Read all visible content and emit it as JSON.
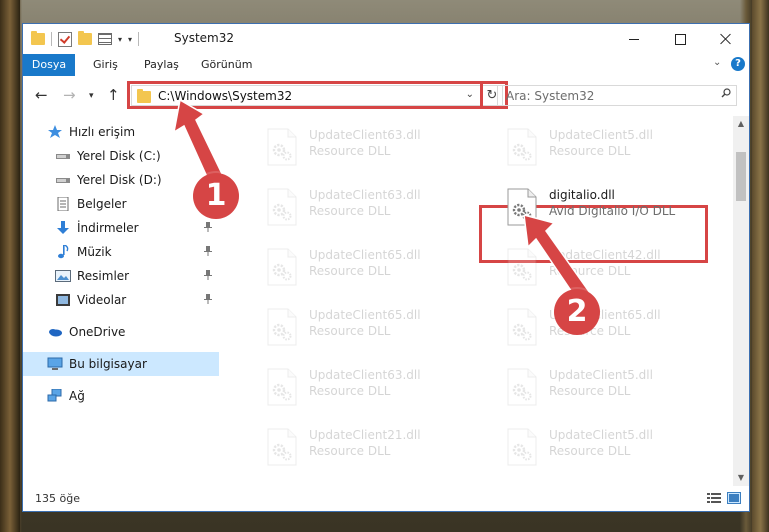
{
  "window": {
    "title": "System32"
  },
  "ribbon": {
    "tabs": [
      "Dosya",
      "Giriş",
      "Paylaş",
      "Görünüm"
    ]
  },
  "address": {
    "path": "C:\\Windows\\System32",
    "search_placeholder": "Ara: System32"
  },
  "nav": {
    "items": [
      {
        "label": "Hızlı erişim",
        "icon": "star-icon"
      },
      {
        "label": "Yerel Disk (C:)",
        "icon": "drive-icon"
      },
      {
        "label": "Yerel Disk (D:)",
        "icon": "drive-icon"
      },
      {
        "label": "Belgeler",
        "icon": "documents-icon"
      },
      {
        "label": "İndirmeler",
        "icon": "download-icon"
      },
      {
        "label": "Müzik",
        "icon": "music-icon"
      },
      {
        "label": "Resimler",
        "icon": "pictures-icon"
      },
      {
        "label": "Videolar",
        "icon": "video-icon"
      },
      {
        "label": "OneDrive",
        "icon": "cloud-icon"
      },
      {
        "label": "Bu bilgisayar",
        "icon": "computer-icon"
      },
      {
        "label": "Ağ",
        "icon": "network-icon"
      }
    ]
  },
  "files": [
    {
      "name": "UpdateClient63.dll",
      "type": "Resource DLL"
    },
    {
      "name": "UpdateClient5.dll",
      "type": "Resource DLL"
    },
    {
      "name": "UpdateClient63.dll",
      "type": "Resource DLL"
    },
    {
      "name": "digitalio.dll",
      "type": "Avid Digitalio I/O DLL"
    },
    {
      "name": "UpdateClient65.dll",
      "type": "Resource DLL"
    },
    {
      "name": "UpdateClient42.dll",
      "type": "Resource DLL"
    },
    {
      "name": "UpdateClient65.dll",
      "type": "Resource DLL"
    },
    {
      "name": "UpdateClient65.dll",
      "type": "Resource DLL"
    },
    {
      "name": "UpdateClient63.dll",
      "type": "Resource DLL"
    },
    {
      "name": "UpdateClient5.dll",
      "type": "Resource DLL"
    },
    {
      "name": "UpdateClient21.dll",
      "type": "Resource DLL"
    },
    {
      "name": "UpdateClient5.dll",
      "type": "Resource DLL"
    }
  ],
  "status": {
    "count": "135 öğe"
  },
  "callouts": {
    "one": "1",
    "two": "2"
  },
  "colors": {
    "accent": "#1979ca",
    "highlight": "#d64545",
    "selected": "#cce8ff"
  }
}
